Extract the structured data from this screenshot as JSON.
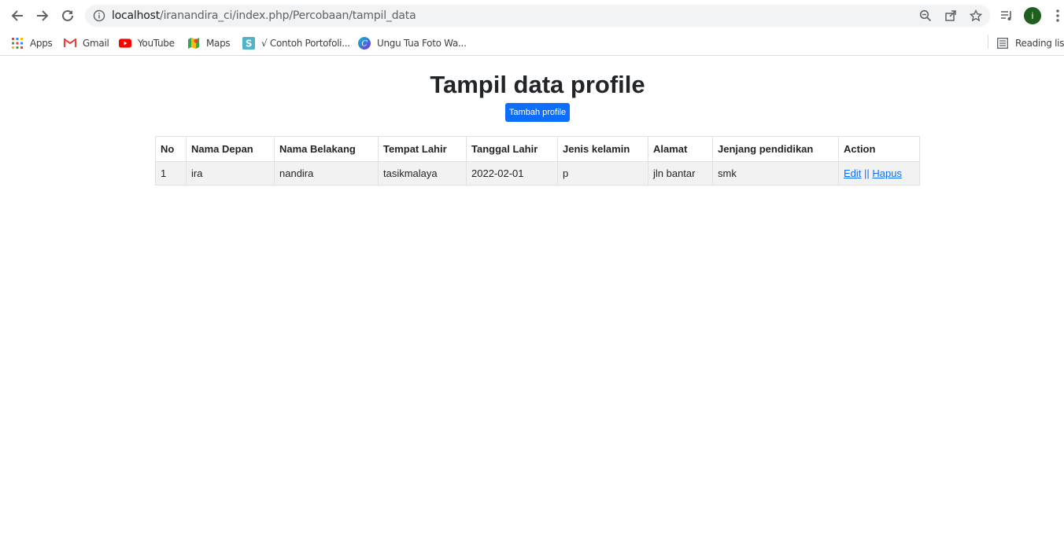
{
  "browser": {
    "url_host": "localhost",
    "url_path": "/iranandira_ci/index.php/Percobaan/tampil_data",
    "avatar_letter": "i",
    "accent_color": "#1a73e8"
  },
  "bookmarks": {
    "items": [
      {
        "label": "Apps",
        "icon": "apps-grid-icon"
      },
      {
        "label": "Gmail",
        "icon": "gmail-icon"
      },
      {
        "label": "YouTube",
        "icon": "youtube-icon"
      },
      {
        "label": "Maps",
        "icon": "maps-icon"
      },
      {
        "label": "√ Contoh Portofoli...",
        "icon": "s-badge-icon"
      },
      {
        "label": "Ungu Tua Foto Wa...",
        "icon": "canva-icon"
      }
    ],
    "reading_list": "Reading list"
  },
  "page": {
    "title": "Tampil data profile",
    "add_button": "Tambah profile",
    "button_color": "#0d6efd"
  },
  "table": {
    "headers": [
      "No",
      "Nama Depan",
      "Nama Belakang",
      "Tempat Lahir",
      "Tanggal Lahir",
      "Jenis kelamin",
      "Alamat",
      "Jenjang pendidikan",
      "Action"
    ],
    "rows": [
      {
        "no": "1",
        "nama_depan": "ira",
        "nama_belakang": "nandira",
        "tempat_lahir": "tasikmalaya",
        "tanggal_lahir": "2022-02-01",
        "jenis_kelamin": "p",
        "alamat": "jln bantar",
        "jenjang": "smk",
        "edit": "Edit",
        "separator": "||",
        "hapus": "Hapus"
      }
    ]
  }
}
